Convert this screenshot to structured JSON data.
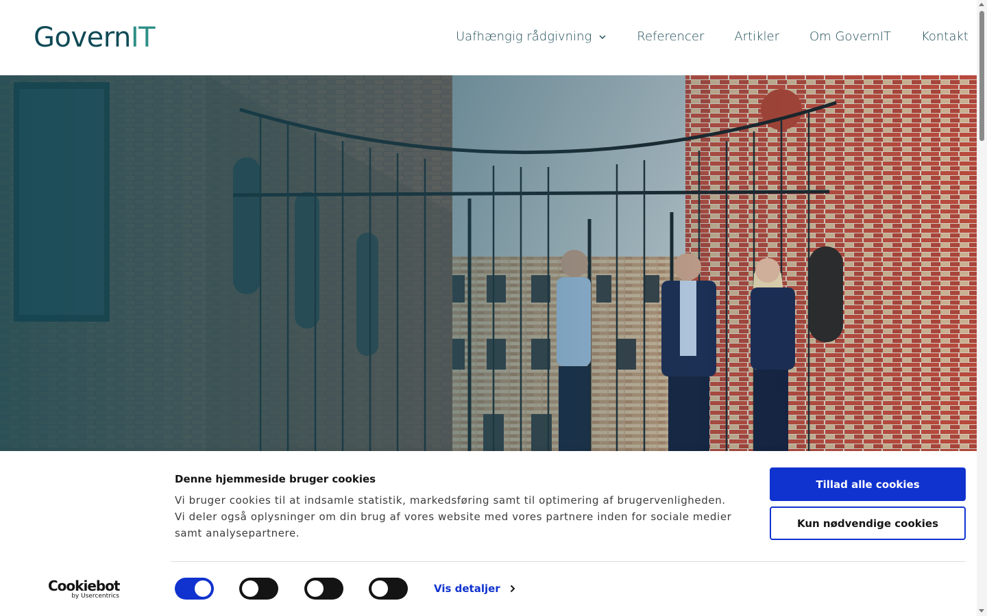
{
  "header": {
    "logo": {
      "part1": "Govern",
      "part2": "IT"
    },
    "nav": [
      {
        "label": "Uafhængig rådgivning",
        "has_dropdown": true
      },
      {
        "label": "Referencer"
      },
      {
        "label": "Artikler"
      },
      {
        "label": "Om GovernIT"
      },
      {
        "label": "Kontakt"
      }
    ]
  },
  "colors": {
    "brand_dark": "#0f4a56",
    "brand_teal": "#2e8f86",
    "cookie_blue": "#1032cf"
  },
  "cookie_banner": {
    "title": "Denne hjemmeside bruger cookies",
    "text": "Vi bruger cookies til at indsamle statistik, markedsføring samt til optimering af brugervenligheden. Vi deler også oplysninger om din brug af vores website med vores partnere inden for sociale medier samt analysepartnere.",
    "allow_all_label": "Tillad alle cookies",
    "necessary_only_label": "Kun nødvendige cookies",
    "brand": {
      "name": "Cookiebot",
      "sub": "by Usercentrics"
    },
    "toggles": [
      {
        "on": true
      },
      {
        "on": false
      },
      {
        "on": false
      },
      {
        "on": false
      }
    ],
    "details_label": "Vis detaljer"
  }
}
